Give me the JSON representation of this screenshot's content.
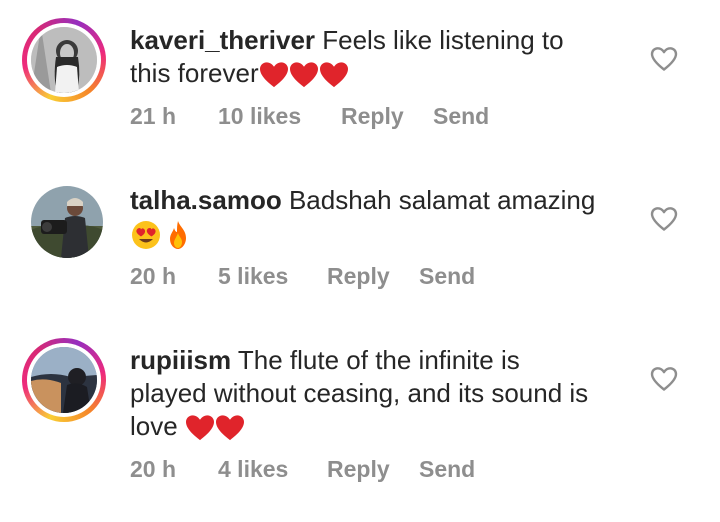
{
  "comments": [
    {
      "username": "kaveri_theriver",
      "text_line1": " Feels like listening to",
      "text_line2": "this forever",
      "time": "21 h",
      "likes": "10 likes",
      "reply": "Reply",
      "send": "Send",
      "emojis": [
        "red-heart",
        "red-heart",
        "red-heart"
      ]
    },
    {
      "username": "talha.samoo",
      "text_line1": " Badshah salamat amazing",
      "time": "20 h",
      "likes": "5 likes",
      "reply": "Reply",
      "send": "Send",
      "emojis": [
        "heart-eyes-face",
        "fire"
      ]
    },
    {
      "username": "rupiiism",
      "text_line1": " The flute of the infinite is",
      "text_line2": "played without ceasing, and its sound is",
      "text_line3": "love ",
      "time": "20 h",
      "likes": "4 likes",
      "reply": "Reply",
      "send": "Send",
      "emojis": [
        "red-heart",
        "red-heart"
      ]
    }
  ],
  "colors": {
    "text": "#262626",
    "meta": "#8e8e8e",
    "heart_emoji": "#e0242b",
    "story_ring_start": "#f9ce34",
    "story_ring_end": "#962fbf"
  },
  "icons": {
    "like": "heart-outline-icon"
  }
}
